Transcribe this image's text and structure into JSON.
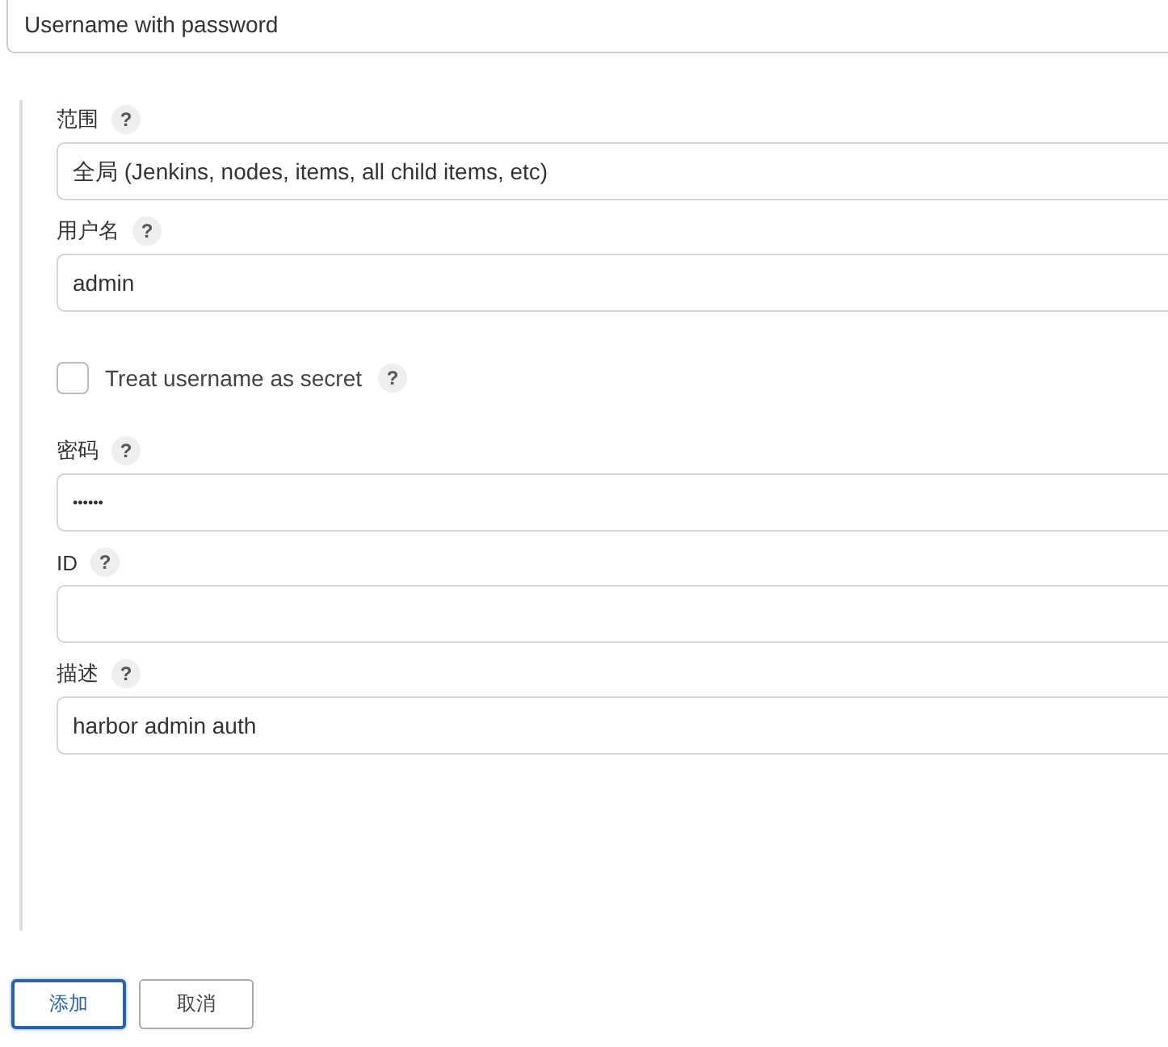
{
  "kind_select": {
    "value": "Username with password"
  },
  "fields": [
    {
      "kind": "text",
      "label": "范围",
      "value": "全局 (Jenkins, nodes, items, all child items, etc)"
    },
    {
      "kind": "text",
      "label": "用户名",
      "value": "admin"
    },
    {
      "kind": "checkbox",
      "label": "Treat username as secret",
      "checked": false
    },
    {
      "kind": "password",
      "label": "密码",
      "value": "••••••"
    },
    {
      "kind": "text",
      "label": "ID"
    },
    {
      "kind": "text",
      "label": "描述",
      "value": "harbor admin auth"
    }
  ],
  "help_glyph": "?",
  "buttons": [
    {
      "label": "添加",
      "primary": true
    },
    {
      "label": "取消",
      "primary": false
    }
  ]
}
